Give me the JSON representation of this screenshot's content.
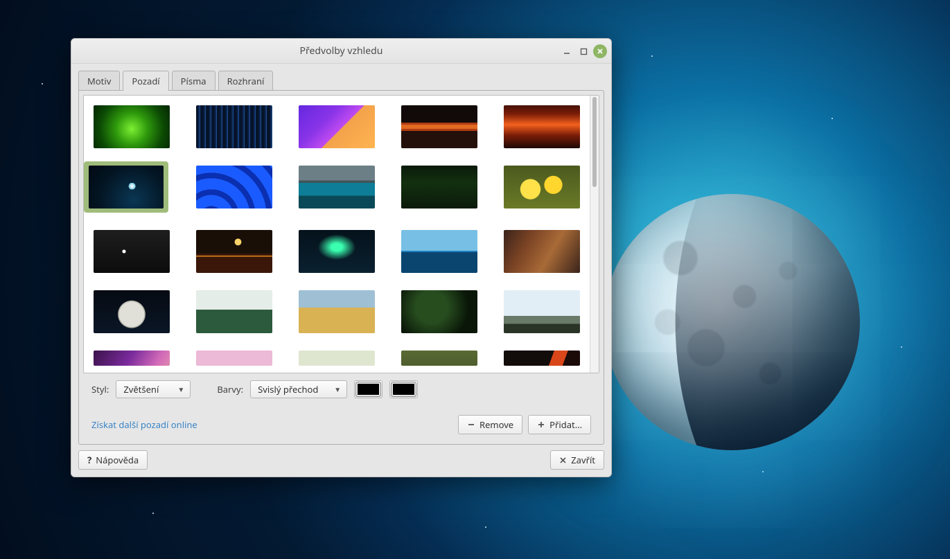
{
  "window": {
    "title": "Předvolby vzhledu"
  },
  "tabs": {
    "motiv": "Motiv",
    "pozadi": "Pozadí",
    "pisma": "Písma",
    "rozhrani": "Rozhraní",
    "active": "pozadi"
  },
  "styleRow": {
    "styl": "Styl:",
    "zvetseni": "Zvětšení",
    "barvy": "Barvy:",
    "svisly": "Svislý přechod"
  },
  "colors": {
    "c1": "#000000",
    "c2": "#000000"
  },
  "actions": {
    "link": "Získat další pozadí online",
    "remove": "Remove",
    "add": "Přidat…"
  },
  "footer": {
    "help": "Nápověda",
    "close": "Zavřít"
  },
  "selectedIndex": 5,
  "wallpapers": [
    {
      "name": "green-gradient",
      "css": "radial-gradient(circle at 50% 55%, #7ef033 0%, #2f9a0c 35%, #0c4b04 70%, #052402 100%)"
    },
    {
      "name": "vertical-blue",
      "css": "repeating-linear-gradient(90deg,#06142b 0 3px,#0c2752 3px 5px,#204d8e 5px 6px,#06142b 6px 8px)"
    },
    {
      "name": "purple-orange-poly",
      "css": "linear-gradient(135deg,#6428e0 0%,#8a34e8 35%,#c04bf0 55%,#f3a24a 55%,#ffb451 100%)"
    },
    {
      "name": "temple-sunset",
      "css": "linear-gradient(#120a08 0 40%, #b13c12 40% 45%, #e06a22 45% 55%,#b13c12 55% 60%, #24100a 60% 100%)"
    },
    {
      "name": "orange-dark",
      "css": "linear-gradient(#451207 0%,#7a1c08 20%,#f3611d 45%,#7a1c08 70%,#1e0a05 100%)"
    },
    {
      "name": "moon-night",
      "css": "radial-gradient(circle at 58% 48%,#dff3fb 0 4%,#8dd0e6 4% 7%, transparent 7%), radial-gradient(circle at 60% 80%,#0a3653 0%,#031523 60%,#010912 100%)"
    },
    {
      "name": "blue-waves",
      "css": "repeating-radial-gradient(circle at 20% 120%,#1a5bff 0 8px,#0a2fb0 8px 16px,#1a5bff 16px 24px)"
    },
    {
      "name": "mountain-lake",
      "css": "linear-gradient(#6d7f86 0 35%,#3f5459 35% 40%,#0e7d97 40% 70%,#0a4a58 70% 100%)"
    },
    {
      "name": "spruce",
      "css": "linear-gradient(#0b1a0a 0%, #12300f 40%, #0b1a0a 100%)"
    },
    {
      "name": "daffodils",
      "css": "radial-gradient(circle at 35% 55%,#ffe24a 0 18%,transparent 19%),radial-gradient(circle at 65% 45%,#ffd62e 0 16%,transparent 17%),linear-gradient(#4b5a1e,#6a7a27)"
    },
    {
      "name": "mint-dark",
      "css": "radial-gradient(circle at 40% 50%,#ffffff 0 3%,transparent 4%),linear-gradient(#1e1e1e,#0c0c0c)"
    },
    {
      "name": "crescent-reflection",
      "css": "radial-gradient(circle at 55% 28%,#ffd36b 0 6%,transparent 7%),linear-gradient(#1a0f07 0 55%,#3a1708 55% 60%,#e08a20 60% 62%,#3a1708 62% 100%)"
    },
    {
      "name": "aurora-tree",
      "css": "radial-gradient(ellipse at 50% 40%,#3affb0 0 10%,transparent 35%),linear-gradient(#05121b,#0a2030)"
    },
    {
      "name": "split-sea",
      "css": "linear-gradient(#78bfe5 0 48%,#1d7fbf 48% 52%,#0a4570 52% 100%)"
    },
    {
      "name": "rusty-door",
      "css": "linear-gradient(120deg,#3a231a 0%,#7a4324 30%,#a86a37 60%,#3a231a 100%)"
    },
    {
      "name": "big-moon",
      "css": "radial-gradient(circle at 50% 56%,#e0e0d8 0 28%,#b8b8ae 28% 30%,transparent 31%),linear-gradient(#060a12,#0a1626)"
    },
    {
      "name": "fog-forest",
      "css": "linear-gradient(#e4ede8 0 45%,#2c5a3c 45% 100%)"
    },
    {
      "name": "wheat-field",
      "css": "linear-gradient(#9fbfd4 0 40%,#d9b254 40% 100%)"
    },
    {
      "name": "leaf-dark",
      "css": "radial-gradient(circle at 40% 40%,#274d1f 0 30%,#0a1708 70%)"
    },
    {
      "name": "sky-mountain",
      "css": "linear-gradient(#e2eef6 0 60%,#6a7a68 60% 78%,#2a3426 78% 100%)"
    },
    {
      "name": "purple-haze",
      "css": "linear-gradient(120deg,#3b134a 0%,#7a2a9c 40%,#d26ab8 70%,#efa9a9 100%)"
    },
    {
      "name": "pink-sunset",
      "css": "linear-gradient(#ecb9d6 0 55%,#a46a8d 55% 100%)"
    },
    {
      "name": "field-line",
      "css": "linear-gradient(#dfe6d0 0 45%,#a08e3b 45% 55%,#6a5a22 55% 100%)"
    },
    {
      "name": "grass-blur",
      "css": "linear-gradient(#5a6a34 0%,#3a4820 100%)"
    },
    {
      "name": "lava-crop",
      "css": "linear-gradient(110deg,#120c0a 0 55%,#d8461a 55% 70%,#1a0a08 70% 100%)"
    }
  ]
}
